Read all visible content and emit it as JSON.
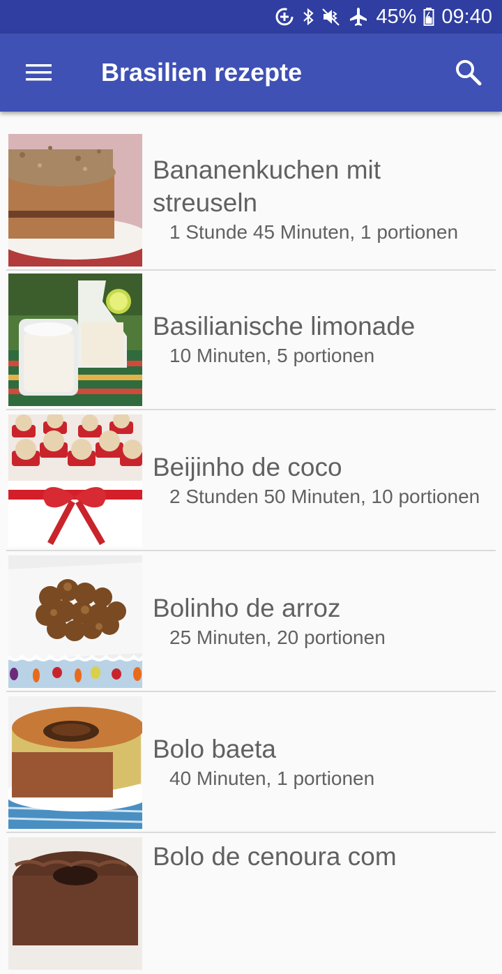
{
  "status_bar": {
    "battery": "45%",
    "time": "09:40",
    "icons": [
      "data-saver-icon",
      "bluetooth-icon",
      "mute-vibrate-icon",
      "airplane-icon",
      "battery-icon"
    ]
  },
  "app_bar": {
    "title": "Brasilien rezepte",
    "menu_icon": "hamburger-menu-icon",
    "search_icon": "search-icon"
  },
  "recipes": [
    {
      "title": "Bananenkuchen mit streuseln",
      "subtitle": "1 Stunde 45 Minuten, 1 portionen"
    },
    {
      "title": "Basilianische limonade",
      "subtitle": "10 Minuten, 5 portionen"
    },
    {
      "title": "Beijinho de coco",
      "subtitle": "2 Stunden 50 Minuten, 10 portionen"
    },
    {
      "title": "Bolinho de arroz",
      "subtitle": "25 Minuten, 20 portionen"
    },
    {
      "title": "Bolo baeta",
      "subtitle": "40 Minuten, 1 portionen"
    },
    {
      "title": "Bolo de cenoura com",
      "subtitle": ""
    }
  ],
  "colors": {
    "status_bar": "#2f3ea0",
    "app_bar": "#3f51b5",
    "background": "#fafafa",
    "text": "#616161",
    "divider": "#dadada"
  }
}
